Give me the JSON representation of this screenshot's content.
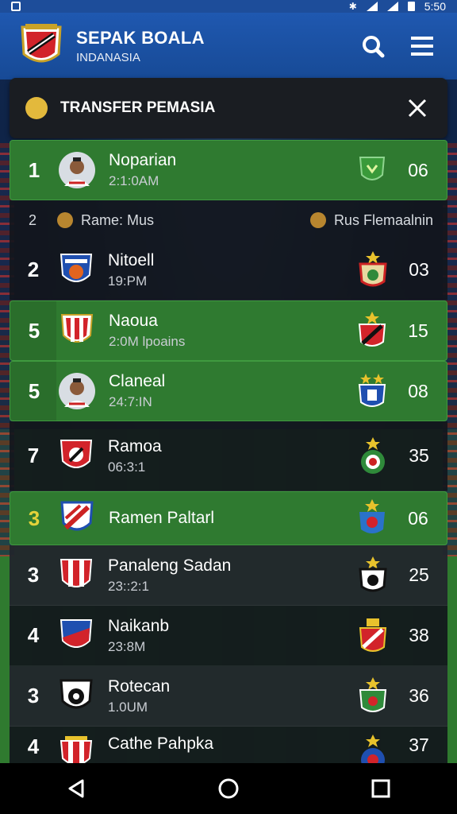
{
  "header": {
    "title": "SEPAK BOALA",
    "subtitle": "INDANASIA",
    "status_time": "5:50"
  },
  "panel": {
    "title": "TRANSFER PEMASIA"
  },
  "subheader": {
    "number": "2",
    "left_label": "Rame: Mus",
    "right_label": "Rus Flemaalnin"
  },
  "rows": [
    {
      "rank": "1",
      "name": "Noparian",
      "sub": "2:1:0AM",
      "score": "06"
    },
    {
      "rank": "2",
      "name": "Nitoell",
      "sub": "19:PM",
      "score": "03"
    },
    {
      "rank": "5",
      "name": "Naoua",
      "sub": "2:0M lpoains",
      "score": "15"
    },
    {
      "rank": "5",
      "name": "Claneal",
      "sub": "24:7:IN",
      "score": "08"
    },
    {
      "rank": "7",
      "name": "Ramoa",
      "sub": "06:3:1",
      "score": "35"
    },
    {
      "rank": "3",
      "name": "Ramen Paltarl",
      "sub": "",
      "score": "06"
    },
    {
      "rank": "3",
      "name": "Panaleng Sadan",
      "sub": "23::2:1",
      "score": "25"
    },
    {
      "rank": "4",
      "name": "Naikanb",
      "sub": "23:8M",
      "score": "38"
    },
    {
      "rank": "3",
      "name": "Rotecan",
      "sub": "1.0UM",
      "score": "36"
    },
    {
      "rank": "4",
      "name": "Cathe Pahpka",
      "sub": "",
      "score": "37"
    }
  ],
  "colors": {
    "header_blue": "#1f58b0",
    "row_green": "#2f7a30",
    "row_dark": "#12161c",
    "accent_yellow": "#e4d23a"
  },
  "icons": {
    "search": "search-icon",
    "menu": "menu-icon",
    "close": "close-icon",
    "nav": [
      "back-icon",
      "home-icon",
      "recents-icon"
    ]
  }
}
